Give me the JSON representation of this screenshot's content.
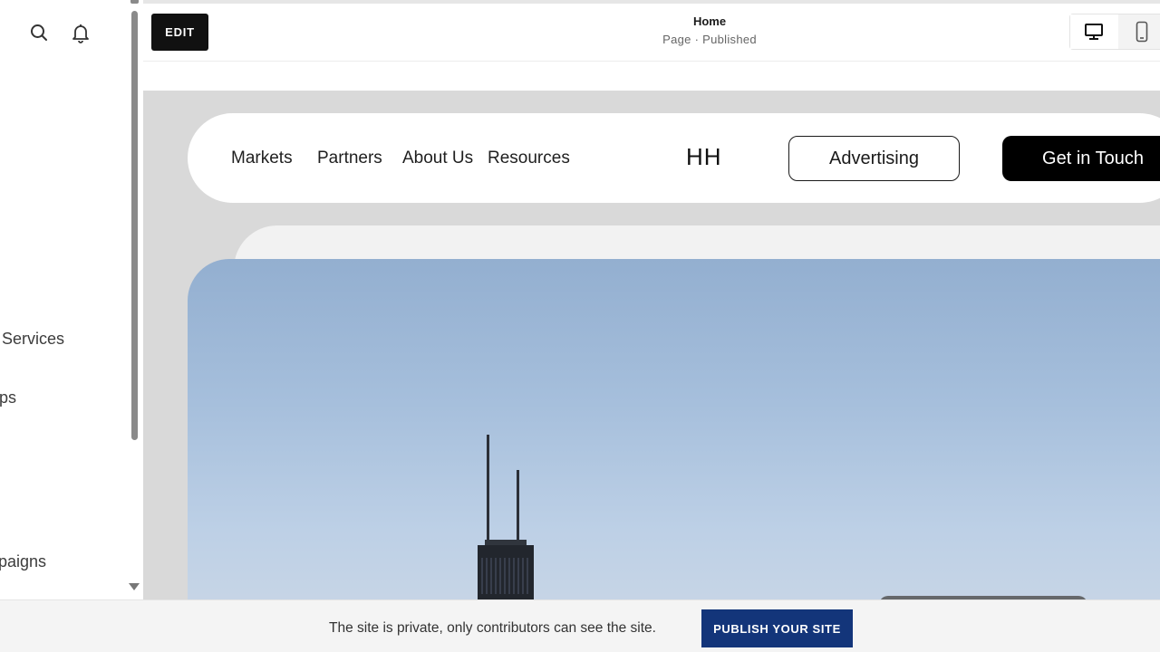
{
  "sidebar": {
    "icons": [
      {
        "name": "search-icon"
      },
      {
        "name": "bell-icon"
      }
    ],
    "items": [
      {
        "label": "Services"
      },
      {
        "label": "ips"
      },
      {
        "label": "paigns"
      }
    ]
  },
  "editor": {
    "edit_label": "EDIT",
    "page_title": "Home",
    "page_status": "Page · Published",
    "view_modes": [
      "desktop-icon",
      "mobile-icon"
    ]
  },
  "site": {
    "nav_links": [
      "Markets",
      "Partners",
      "About Us",
      "Resources"
    ],
    "logo": "HH",
    "advertising_label": "Advertising",
    "cta_label": "Get in Touch"
  },
  "notice": {
    "text": "The site is private, only contributors can see the site.",
    "publish_label": "PUBLISH YOUR SITE"
  },
  "colors": {
    "publish_button": "#13357a",
    "edit_button": "#111111",
    "canvas_background": "#d9d9d9"
  }
}
